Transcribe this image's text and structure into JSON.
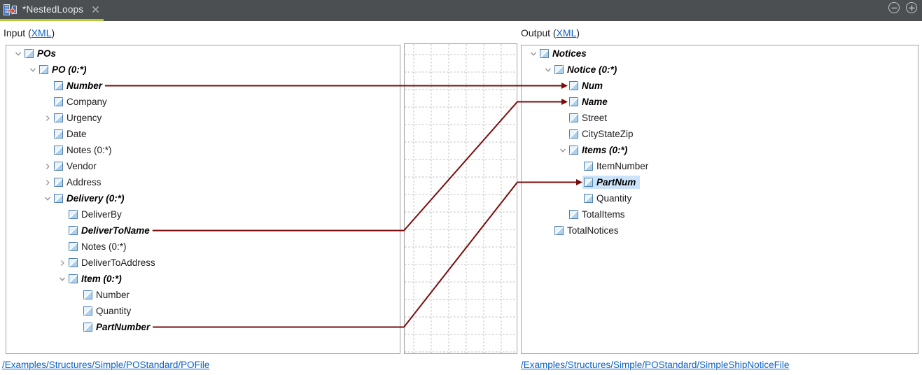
{
  "tab_bar": {
    "tab": {
      "title": "*NestedLoops"
    }
  },
  "headers": {
    "input": {
      "prefix": "Input (",
      "link": "XML",
      "suffix": ")"
    },
    "output": {
      "prefix": "Output (",
      "link": "XML",
      "suffix": ")"
    }
  },
  "footers": {
    "input_path": "/Examples/Structures/Simple/POStandard/POFile",
    "output_path": "/Examples/Structures/Simple/POStandard/SimpleShipNoticeFile"
  },
  "colors": {
    "connection": "#7a0c0c",
    "tab_underline": "#b2cb33",
    "link": "#0b61c4",
    "selection_highlight": "#cbe4f9",
    "grid_dash": "#c0c0c0"
  },
  "trees": {
    "input": {
      "nodes": [
        {
          "label": "POs",
          "level": 0,
          "bold": true,
          "chevron": "down",
          "selected": false
        },
        {
          "label": "PO (0:*)",
          "level": 1,
          "bold": true,
          "chevron": "down",
          "selected": false
        },
        {
          "label": "Number",
          "level": 2,
          "bold": true,
          "chevron": "",
          "selected": false
        },
        {
          "label": "Company",
          "level": 2,
          "bold": false,
          "chevron": "",
          "selected": false
        },
        {
          "label": "Urgency",
          "level": 2,
          "bold": false,
          "chevron": "right",
          "selected": false
        },
        {
          "label": "Date",
          "level": 2,
          "bold": false,
          "chevron": "",
          "selected": false
        },
        {
          "label": "Notes (0:*)",
          "level": 2,
          "bold": false,
          "chevron": "",
          "selected": false
        },
        {
          "label": "Vendor",
          "level": 2,
          "bold": false,
          "chevron": "right",
          "selected": false
        },
        {
          "label": "Address",
          "level": 2,
          "bold": false,
          "chevron": "right",
          "selected": false
        },
        {
          "label": "Delivery (0:*)",
          "level": 2,
          "bold": true,
          "chevron": "down",
          "selected": false
        },
        {
          "label": "DeliverBy",
          "level": 3,
          "bold": false,
          "chevron": "",
          "selected": false
        },
        {
          "label": "DeliverToName",
          "level": 3,
          "bold": true,
          "chevron": "",
          "selected": false
        },
        {
          "label": "Notes (0:*)",
          "level": 3,
          "bold": false,
          "chevron": "",
          "selected": false
        },
        {
          "label": "DeliverToAddress",
          "level": 3,
          "bold": false,
          "chevron": "right",
          "selected": false
        },
        {
          "label": "Item (0:*)",
          "level": 3,
          "bold": true,
          "chevron": "down",
          "selected": false
        },
        {
          "label": "Number",
          "level": 4,
          "bold": false,
          "chevron": "",
          "selected": false
        },
        {
          "label": "Quantity",
          "level": 4,
          "bold": false,
          "chevron": "",
          "selected": false
        },
        {
          "label": "PartNumber",
          "level": 4,
          "bold": true,
          "chevron": "",
          "selected": false
        }
      ]
    },
    "output": {
      "nodes": [
        {
          "label": "Notices",
          "level": 0,
          "bold": true,
          "chevron": "down",
          "selected": false
        },
        {
          "label": "Notice (0:*)",
          "level": 1,
          "bold": true,
          "chevron": "down",
          "selected": false
        },
        {
          "label": "Num",
          "level": 2,
          "bold": true,
          "chevron": "",
          "selected": false
        },
        {
          "label": "Name",
          "level": 2,
          "bold": true,
          "chevron": "",
          "selected": false
        },
        {
          "label": "Street",
          "level": 2,
          "bold": false,
          "chevron": "",
          "selected": false
        },
        {
          "label": "CityStateZip",
          "level": 2,
          "bold": false,
          "chevron": "",
          "selected": false
        },
        {
          "label": "Items (0:*)",
          "level": 2,
          "bold": true,
          "chevron": "down",
          "selected": false
        },
        {
          "label": "ItemNumber",
          "level": 3,
          "bold": false,
          "chevron": "",
          "selected": false
        },
        {
          "label": "PartNum",
          "level": 3,
          "bold": true,
          "chevron": "",
          "selected": true
        },
        {
          "label": "Quantity",
          "level": 3,
          "bold": false,
          "chevron": "",
          "selected": false
        },
        {
          "label": "TotalItems",
          "level": 2,
          "bold": false,
          "chevron": "",
          "selected": false
        },
        {
          "label": "TotalNotices",
          "level": 1,
          "bold": false,
          "chevron": "",
          "selected": false
        }
      ]
    }
  },
  "connections": [
    {
      "from_label": "Number",
      "from_index": 2,
      "to_label": "Num",
      "to_index": 2
    },
    {
      "from_label": "DeliverToName",
      "from_index": 11,
      "to_label": "Name",
      "to_index": 3
    },
    {
      "from_label": "PartNumber",
      "from_index": 17,
      "to_label": "PartNum",
      "to_index": 8
    }
  ]
}
